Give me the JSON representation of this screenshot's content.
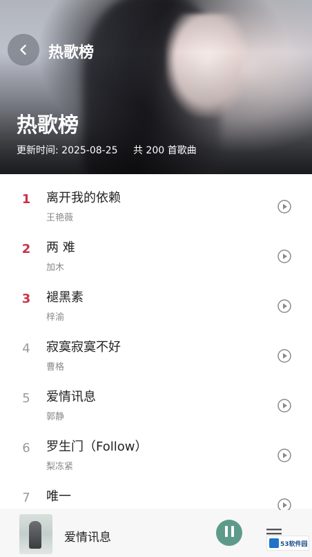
{
  "header": {
    "nav_title": "热歌榜",
    "page_title": "热歌榜",
    "updated": "更新时间: 2025-08-25",
    "count": "共 200 首歌曲"
  },
  "songs": [
    {
      "rank": "1",
      "title": "离开我的依赖",
      "artist": "王艳薇",
      "top": true
    },
    {
      "rank": "2",
      "title": "两 难",
      "artist": "加木",
      "top": true
    },
    {
      "rank": "3",
      "title": "褪黑素",
      "artist": "梓渝",
      "top": true
    },
    {
      "rank": "4",
      "title": "寂寞寂寞不好",
      "artist": "曹格",
      "top": false
    },
    {
      "rank": "5",
      "title": "爱情讯息",
      "artist": "郭静",
      "top": false
    },
    {
      "rank": "6",
      "title": "罗生门（Follow）",
      "artist": "梨冻紧",
      "top": false
    },
    {
      "rank": "7",
      "title": "唯一",
      "artist": "",
      "top": false
    }
  ],
  "player": {
    "now_playing": "爱情讯息",
    "state": "playing"
  },
  "watermark": "53软件园",
  "colors": {
    "rank_top": "#c9334a",
    "rank_normal": "#999999",
    "accent": "#5e9a8a"
  },
  "icons": [
    "back-icon",
    "play-circle-icon",
    "pause-icon",
    "playlist-icon"
  ]
}
